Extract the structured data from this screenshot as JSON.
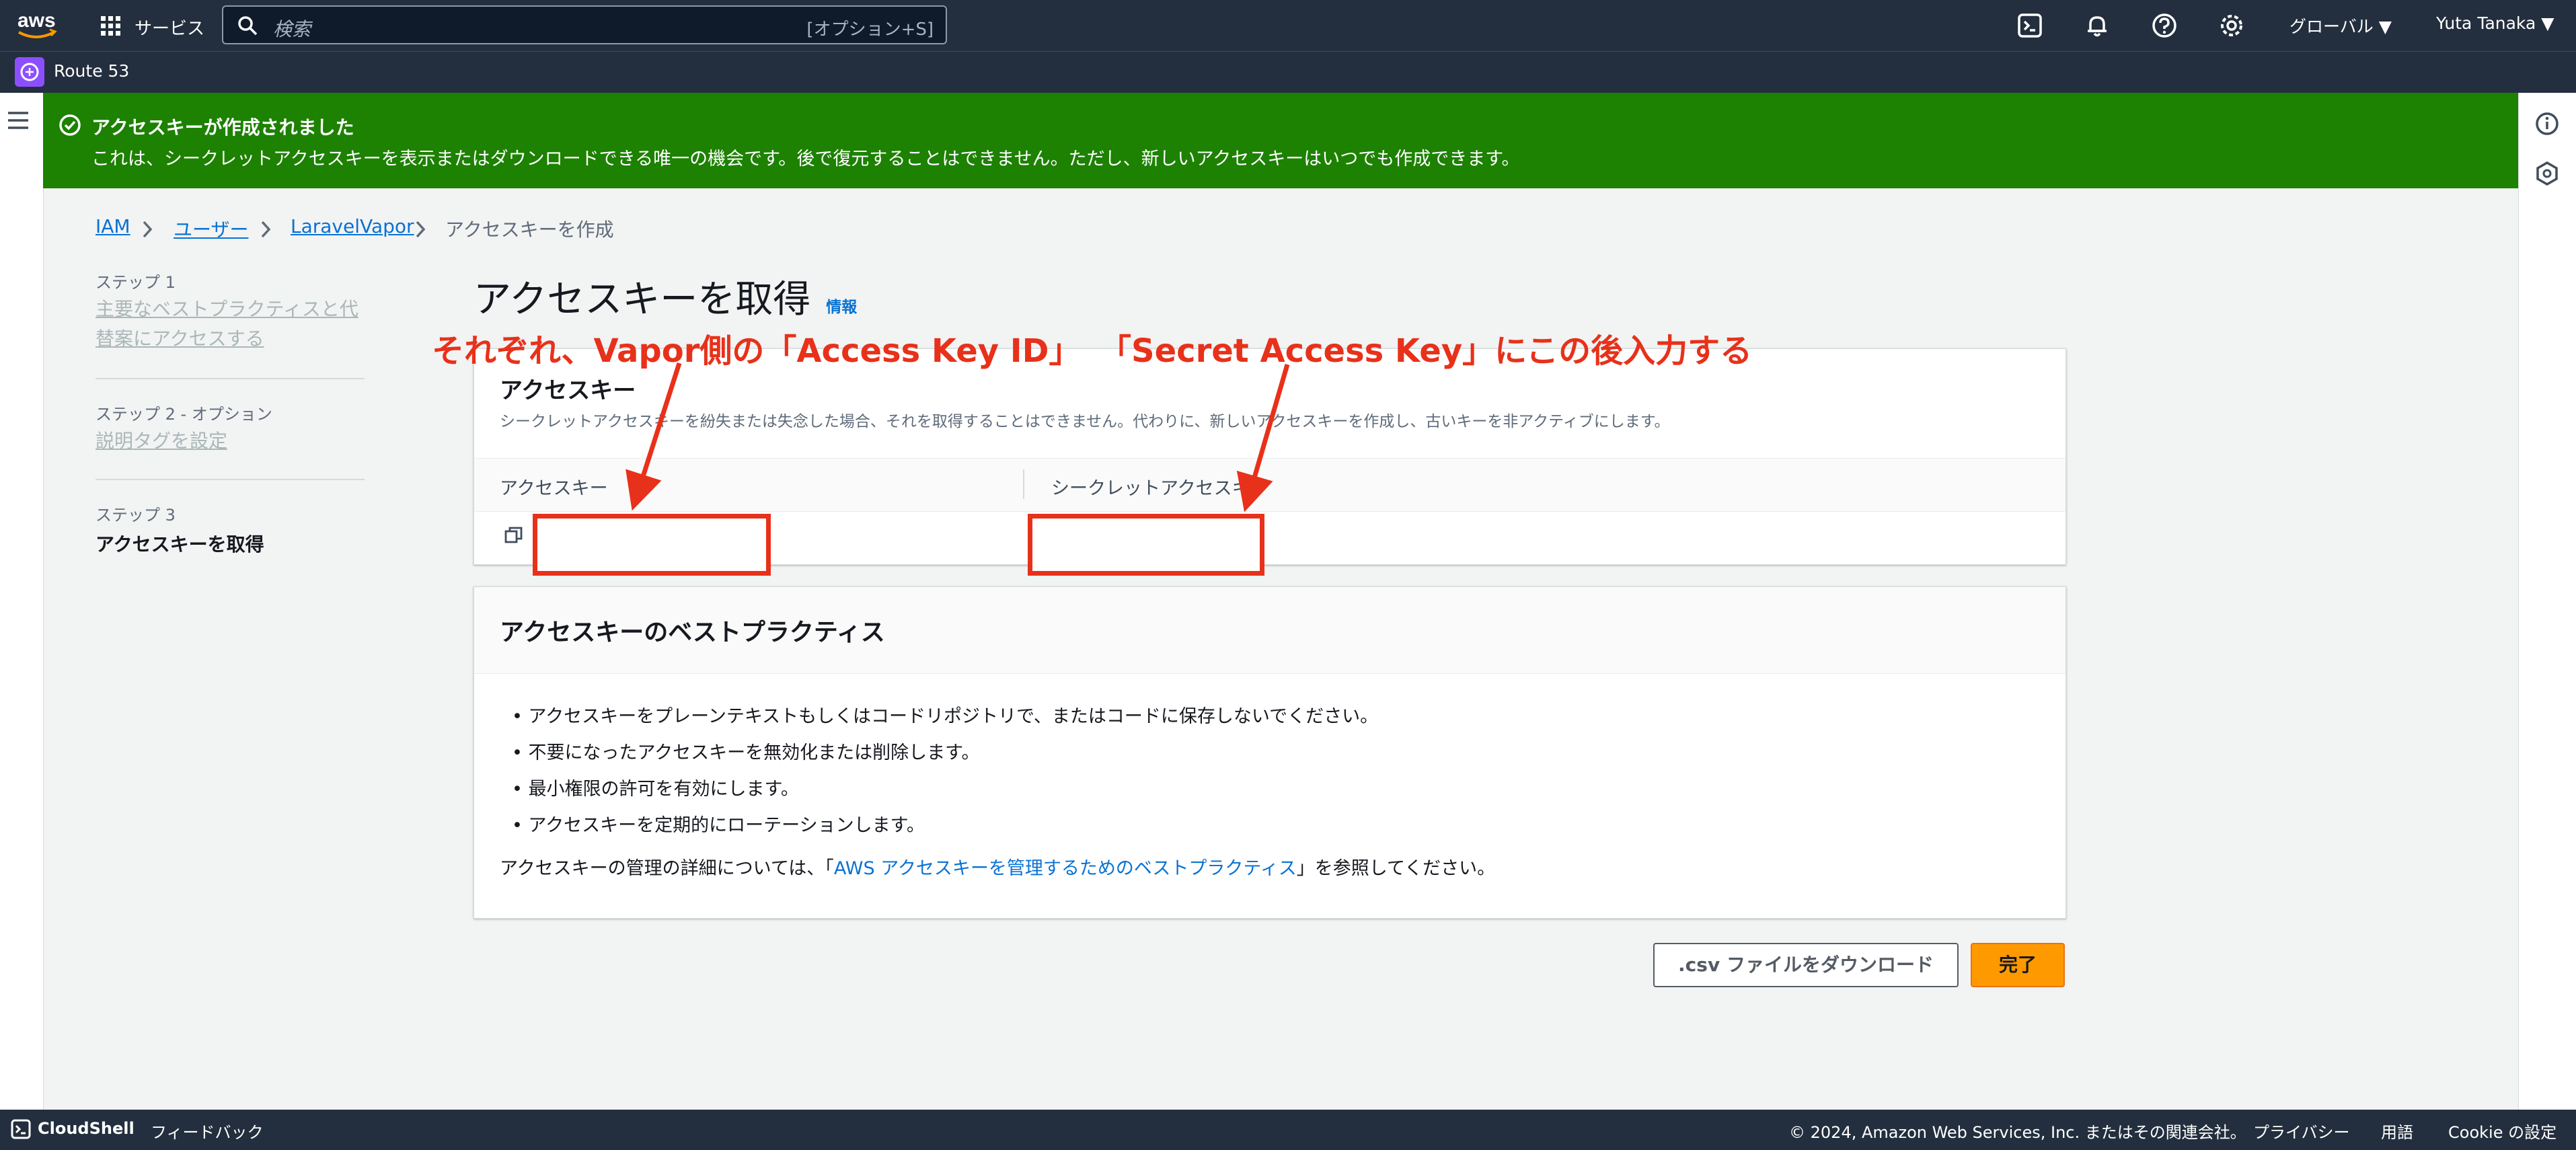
{
  "nav": {
    "services_label": "サービス",
    "search_placeholder": "検索",
    "search_shortcut": "[オプション+S]",
    "region": "グローバル ▼",
    "user": "Yuta Tanaka ▼",
    "service_name": "Route 53"
  },
  "flash": {
    "title": "アクセスキーが作成されました",
    "message": "これは、シークレットアクセスキーを表示またはダウンロードできる唯一の機会です。後で復元することはできません。ただし、新しいアクセスキーはいつでも作成できます。"
  },
  "breadcrumb": {
    "items": [
      "IAM",
      "ユーザー",
      "LaravelVapor"
    ],
    "current": "アクセスキーを作成"
  },
  "steps": [
    {
      "label": "ステップ 1",
      "title": "主要なベストプラクティスと代替案にアクセスする"
    },
    {
      "label": "ステップ 2 - オプション",
      "title": "説明タグを設定"
    },
    {
      "label": "ステップ 3",
      "title": "アクセスキーを取得"
    }
  ],
  "page": {
    "title": "アクセスキーを取得",
    "info": "情報"
  },
  "access_key_card": {
    "title": "アクセスキー",
    "description": "シークレットアクセスキーを紛失または失念した場合、それを取得することはできません。代わりに、新しいアクセスキーを作成し、古いキーを非アクティブにします。",
    "col1": "アクセスキー",
    "col2": "シークレットアクセスキー"
  },
  "best_practices": {
    "title": "アクセスキーのベストプラクティス",
    "bullets": [
      "アクセスキーをプレーンテキストもしくはコードリポジトリで、またはコードに保存しないでください。",
      "不要になったアクセスキーを無効化または削除します。",
      "最小権限の許可を有効にします。",
      "アクセスキーを定期的にローテーションします。"
    ],
    "footer_prefix": "アクセスキーの管理の詳細については、「",
    "footer_link": "AWS アクセスキーを管理するためのベストプラクティス",
    "footer_suffix": "」を参照してください。"
  },
  "buttons": {
    "download": ".csv ファイルをダウンロード",
    "done": "完了"
  },
  "annotations": {
    "left": "それぞれ、Vapor側の「Access Key ID」",
    "right": "「Secret Access Key」にこの後入力する"
  },
  "footer": {
    "cloudshell": "CloudShell",
    "feedback": "フィードバック",
    "copyright": "© 2024, Amazon Web Services, Inc. またはその関連会社。",
    "privacy": "プライバシー",
    "terms": "用語",
    "cookie": "Cookie の設定"
  },
  "colors": {
    "nav_bg": "#232f3e",
    "success": "#1d8102",
    "link": "#0972d3",
    "primary": "#ff9900",
    "annotation": "#e8311a"
  }
}
